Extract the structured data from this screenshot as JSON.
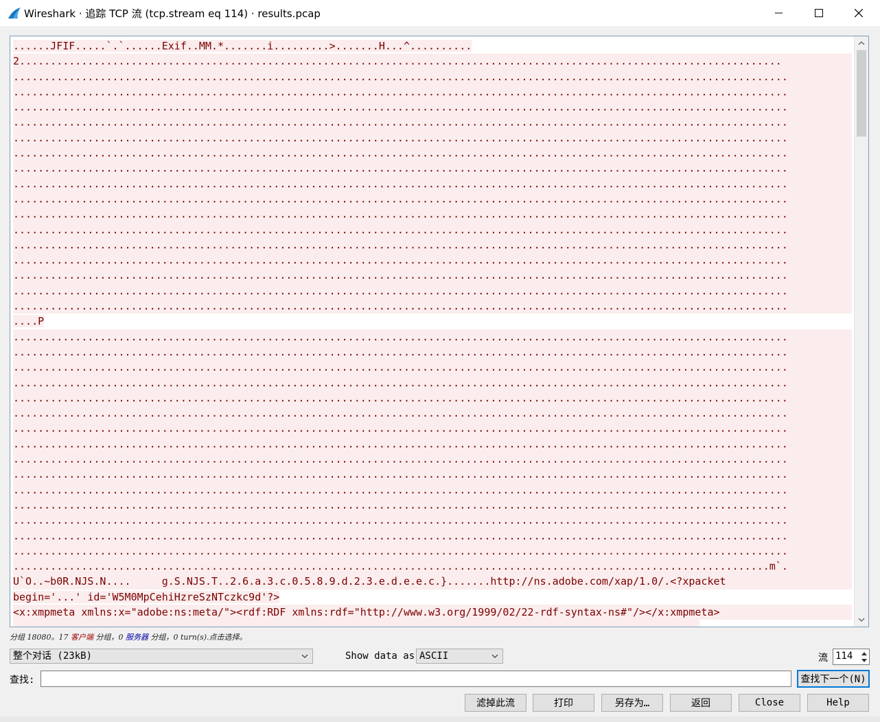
{
  "window": {
    "title": "Wireshark · 追踪 TCP 流 (tcp.stream eq 114) · results.pcap",
    "controls": [
      "minimize-icon",
      "maximize-icon",
      "close-icon"
    ]
  },
  "stream": {
    "lines": [
      "......JFIF.....`.`......Exif..MM.*.......i.........>.......H...^..........",
      "2...........................................................................................................................",
      ".............................................................................................................................",
      ".............................................................................................................................",
      ".............................................................................................................................",
      ".............................................................................................................................",
      ".............................................................................................................................",
      ".............................................................................................................................",
      ".............................................................................................................................",
      ".............................................................................................................................",
      ".............................................................................................................................",
      ".............................................................................................................................",
      ".............................................................................................................................",
      ".............................................................................................................................",
      ".............................................................................................................................",
      ".............................................................................................................................",
      ".............................................................................................................................",
      ".............................................................................................................................",
      "....P",
      ".............................................................................................................................",
      ".............................................................................................................................",
      ".............................................................................................................................",
      ".............................................................................................................................",
      ".............................................................................................................................",
      ".............................................................................................................................",
      ".............................................................................................................................",
      ".............................................................................................................................",
      ".............................................................................................................................",
      ".............................................................................................................................",
      ".............................................................................................................................",
      ".............................................................................................................................",
      ".............................................................................................................................",
      ".............................................................................................................................",
      ".............................................................................................................................",
      "..........................................................................................................................m`.",
      "U`O..~b0R.NJS.N....     g.S.NJS.T..2.6.a.3.c.0.5.8.9.d.2.3.e.d.e.e.c.}.......http://ns.adobe.com/xap/1.0/.<?xpacket",
      "begin='...' id='W5M0MpCehiHzreSzNTczkc9d'?>",
      "<x:xmpmeta xmlns:x=\"adobe:ns:meta/\"><rdf:RDF xmlns:rdf=\"http://www.w3.org/1999/02/22-rdf-syntax-ns#\"/></x:xmpmeta>",
      ""
    ]
  },
  "status": {
    "prefix": "分组 18080。17 ",
    "client_label": "客户端",
    "middle": " 分组，0 ",
    "server_label": "服务器",
    "suffix": " 分组，0 turn(s).点击选择。"
  },
  "controls": {
    "conversation_select": "整个对话 (23kB)",
    "show_data_label": "Show data as",
    "show_data_select": "ASCII",
    "stream_label": "流",
    "stream_value": "114"
  },
  "find": {
    "label": "查找:",
    "value": "",
    "find_next_button": "查找下一个(N)"
  },
  "buttons": {
    "filter_out": "滤掉此流",
    "print": "打印",
    "save_as": "另存为…",
    "back": "返回",
    "close": "Close",
    "help": "Help"
  },
  "colors": {
    "client_text": "#7a0000",
    "client_background": "#fbeded",
    "accent": "#0078d7"
  }
}
